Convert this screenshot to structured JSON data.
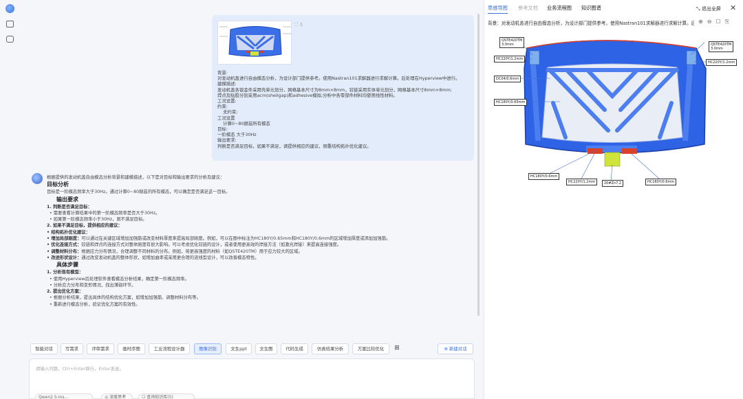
{
  "rail": {
    "icons": [
      "app-logo-icon",
      "sidebar-toggle-icon",
      "new-chat-icon"
    ]
  },
  "user_message": {
    "image_tools": "⛶ ⇩",
    "text": "背景:\n对发动机盖进行自由模态分析，为设计部门提供参考。使用Nastran101求解器进行求解计算。后处理在Hyperview中进行。\n建模描述:\n发动机盖各钣金件采用壳单元划分，网格基本尺寸为8mm×8mm，铰链采用实体单元划分，网格基本尺寸8mm×8mm;\n焊点及贴胶分别采用acm(shellgap)和adhesive模拟;分析中各零部件材料均使用线性材料。\n工况设置:\n约束:\n    无约束;\n工况设置\n    计算0~80赫兹所有模态\n目标:\n一阶模态 大于30Hz\n输出要求:\n判断是否满足目标，如果不满足，请提供相应的建议，侧重结构拓扑优化建议。"
  },
  "assistant_message": {
    "intro": "根据提供的发动机盖自由模态分析背景和建模描述，以下是对目标和输出要求的分析及建议：",
    "h1": "目标分析",
    "p1": "目标是一阶模态频率大于30Hz。通过计算0~80赫兹的所有模态，可以确定是否满足这一目标。",
    "h2": "输出要求",
    "l1": "1. 判断是否满足目标：",
    "l1a": "• 需要查看计算结果中的第一阶模态频率是否大于30Hz。",
    "l1b": "• 如果第一阶模态频率小于30Hz，则不满足目标。",
    "l2": "2. 如果不满足目标，提供相应的建议：",
    "l2h": "• 结构拓扑优化建议：",
    "s1b": "• 增加局部刚度：",
    "s1": "可以通过在关键区域增加加强筋或改变材料厚度来提高局部刚度。例如，可以在图中标注为HC180Y/0.65mm和HC180Y/0.6mm的区域增加厚度或添加加强筋。",
    "s2b": "• 优化连接方式：",
    "s2": "铰链和焊点的连接方式对整体刚度有很大影响。可以考虑优化铰链的设计，或者使用更高效的焊接方法（如激光焊接）来提高连接强度。",
    "s3b": "• 调整材料分布：",
    "s3": "根据应力分布情况，合理调整不同材料的分布。例如，将更高强度的材料（如QSTE420TM）用于应力较大的区域。",
    "s4b": "• 改进形状设计：",
    "s4": "通过改变发动机盖的整体形状，如增加曲率或采用更合理的流线型设计，可以改善模态特性。",
    "h3": "具体步骤",
    "k1": "1. 分析现有模型：",
    "k1a": "• 使用Hyperview后处理软件查看模态分析结果，确定第一阶模态频率。",
    "k1b": "• 分析应力分布和变形情况，找出薄弱环节。",
    "k2": "2. 提出优化方案：",
    "k2a": "• 根据分析结果，提出具体的结构优化方案，如增加加强筋、调整材料分布等。",
    "k2b": "• 重新进行模态分析，验证优化方案的有效性。"
  },
  "toolbar": {
    "buttons": [
      "智能对话",
      "写需求",
      "评审需求",
      "画时序图",
      "工业流程设计器",
      "图像识别",
      "文生ppt",
      "文生图",
      "代码生成",
      "仿真结果分析",
      "方案比较优化"
    ],
    "active_index": 5,
    "grid_icon": "grid-icon",
    "new_chat": "新建对话"
  },
  "input": {
    "placeholder": "请输入问题，Ctrl+Enter换行，Enter发送。",
    "options": [
      "Qwen2.5-Ins...",
      "◎ 深度思考",
      "☐ 查询知识库(5)"
    ]
  },
  "panel": {
    "tabs": [
      "思维导图",
      "参考文档",
      "业务流程图",
      "知识图谱"
    ],
    "active_tab": 0,
    "exit_fullscreen": "退出全屏",
    "background_line": "背景：对发动机盖进行自由模态分析，为设计部门提供参考。使用Nastran101求解器进行求解计算。后...",
    "labels": {
      "qste_left": "QSTE420TM\n3.0mm",
      "qste_right": "QSTE420TM\n3.0mm",
      "hc220_left": "HC220Y/1.2mm",
      "hc220_right": "HC220Y/1.2mm",
      "dc04": "DC04/0.6mm",
      "hc180_left": "HC180Y/0.65mm",
      "hc180_bl": "HC180Y/0.6mm",
      "hc220_bottom": "HC220Y/1.2mm",
      "zinc": "20#Zn7.2",
      "hc180_br": "HC180Y/0.6mm"
    }
  },
  "colors": {
    "accent": "#3d6fd8",
    "hood_blue": "#2f63e6",
    "frame_blue": "#4c7ef0",
    "hinge_red": "#d9412a",
    "lock_yellow": "#cfe33a"
  }
}
